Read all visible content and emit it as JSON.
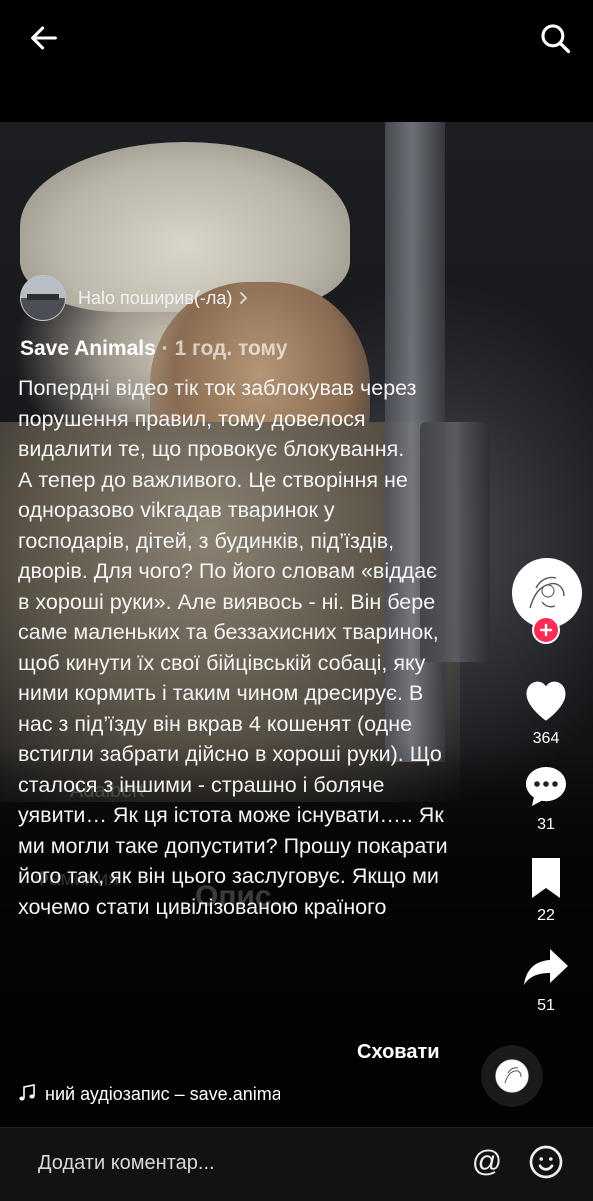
{
  "post": {
    "shared_by": "Halo поширив(-ла)",
    "author": "Save Animals",
    "time": "· 1 год. тому",
    "description": "Попердні відео тік ток заблокував через порушення правил, тому довелося видалити те, що провокує блокування.\nА тепер до важливого. Це створіння не одноразово vikгадав тваринок у господарів, дітей, з будинків, під’їздів, дворів. Для чого? По його словам «віддає в хороші руки». Але виявось - ні. Він бере саме маленьких та беззахисних тваринок, щоб кинути їх свої бійцівській собаці, яку ними кормить і таким чином дресирує. В нас з під’їзду він вкрав 4 кошенят (одне встигли забрати дійсно в хороші руки). Що сталося з іншими - страшно і боляче уявити… Як ця істота може існувати….. Як ми могли таке допустити? Прошу покарати його так, як він цього заслуговує. Якщо ми хочемо стати цивілізованою країного",
    "hide_label": "Сховати",
    "music": "ний аудіозапис – save.animals"
  },
  "video_overlay": {
    "ghost_name": "Adalbert",
    "ghost_field": "Фамилия",
    "ghost_caption": "Опис..."
  },
  "actions": {
    "likes": "364",
    "comments": "31",
    "saves": "22",
    "shares": "51"
  },
  "comment_bar": {
    "placeholder": "Додати коментар...",
    "mention_icon": "@"
  },
  "colors": {
    "accent": "#fe2c55",
    "background": "#000000",
    "comment_bar": "#121212"
  },
  "icons": [
    "back-arrow-icon",
    "search-icon",
    "heart-icon",
    "comment-icon",
    "bookmark-icon",
    "share-arrow-icon",
    "music-note-icon",
    "mention-icon",
    "emoji-icon",
    "plus-icon"
  ]
}
